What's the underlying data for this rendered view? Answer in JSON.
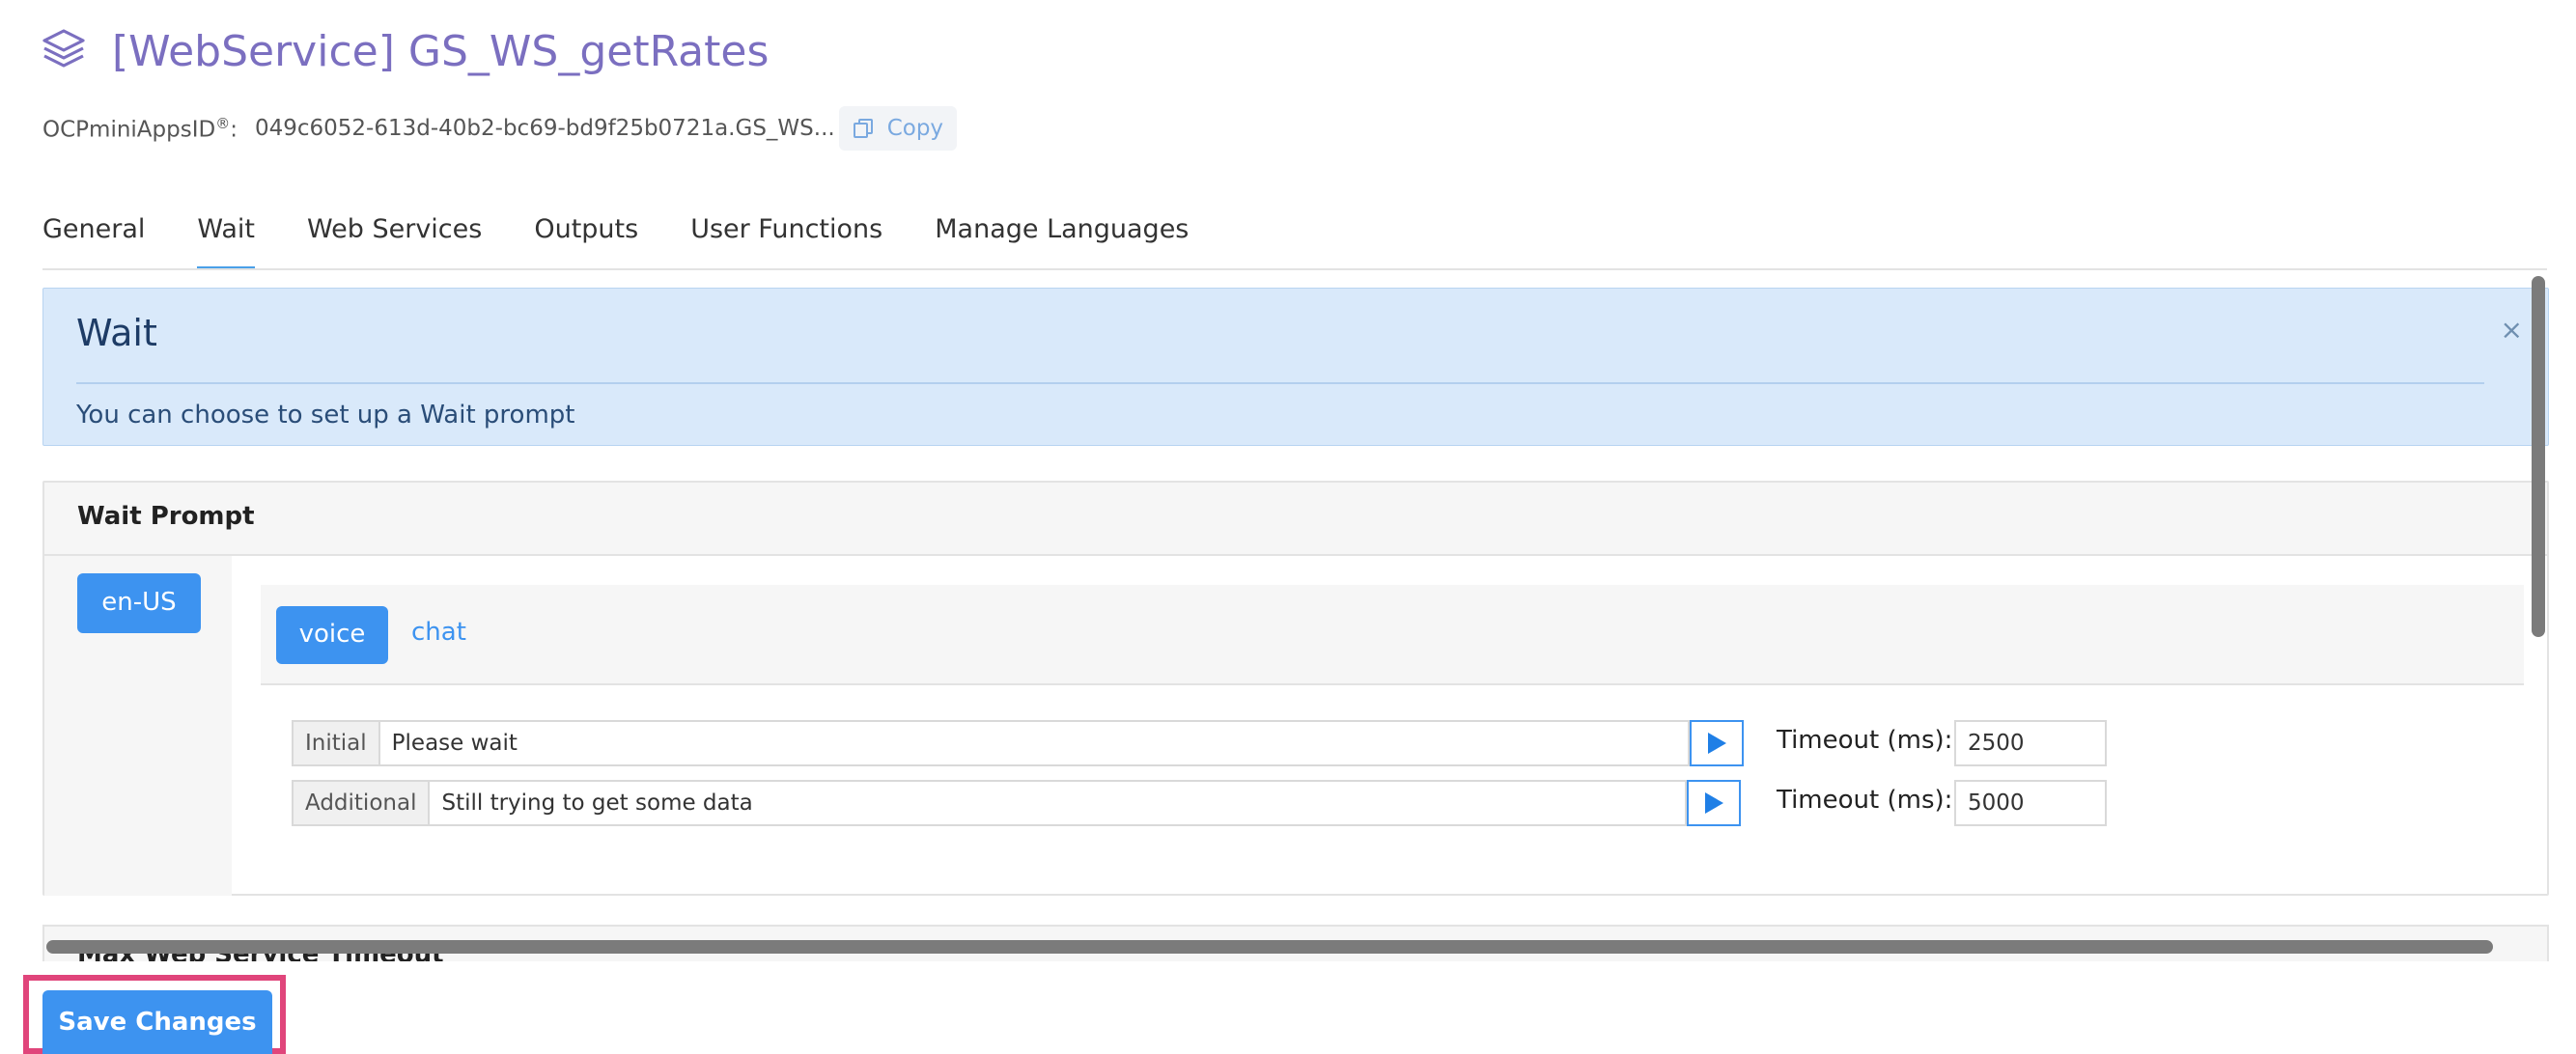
{
  "header": {
    "title": "[WebService] GS_WS_getRates",
    "app_id_label": "OCPminiAppsID",
    "app_id_sup": "®",
    "app_id_suffix": ":",
    "app_id_value": "049c6052-613d-40b2-bc69-bd9f25b0721a.GS_WS...",
    "copy_label": "Copy",
    "icon": "layers-icon"
  },
  "tabs": [
    {
      "label": "General",
      "active": false
    },
    {
      "label": "Wait",
      "active": true
    },
    {
      "label": "Web Services",
      "active": false
    },
    {
      "label": "Outputs",
      "active": false
    },
    {
      "label": "User Functions",
      "active": false
    },
    {
      "label": "Manage Languages",
      "active": false
    }
  ],
  "alert": {
    "title": "Wait",
    "text": "You can choose to set up a Wait prompt",
    "close": "×"
  },
  "wait_prompt": {
    "title": "Wait Prompt",
    "language": "en-US",
    "channels": {
      "voice": "voice",
      "chat": "chat"
    },
    "rows": [
      {
        "label": "Initial",
        "value": "Please wait",
        "timeout_label": "Timeout (ms):",
        "timeout_value": "2500"
      },
      {
        "label": "Additional",
        "value": "Still trying to get some data",
        "timeout_label": "Timeout (ms):",
        "timeout_value": "5000"
      }
    ]
  },
  "next_section": {
    "title": "Max Web Service Timeout"
  },
  "footer": {
    "save_label": "Save Changes"
  },
  "colors": {
    "accent": "#3d93f0",
    "title": "#7b6fc0",
    "highlight": "#e0457b"
  }
}
